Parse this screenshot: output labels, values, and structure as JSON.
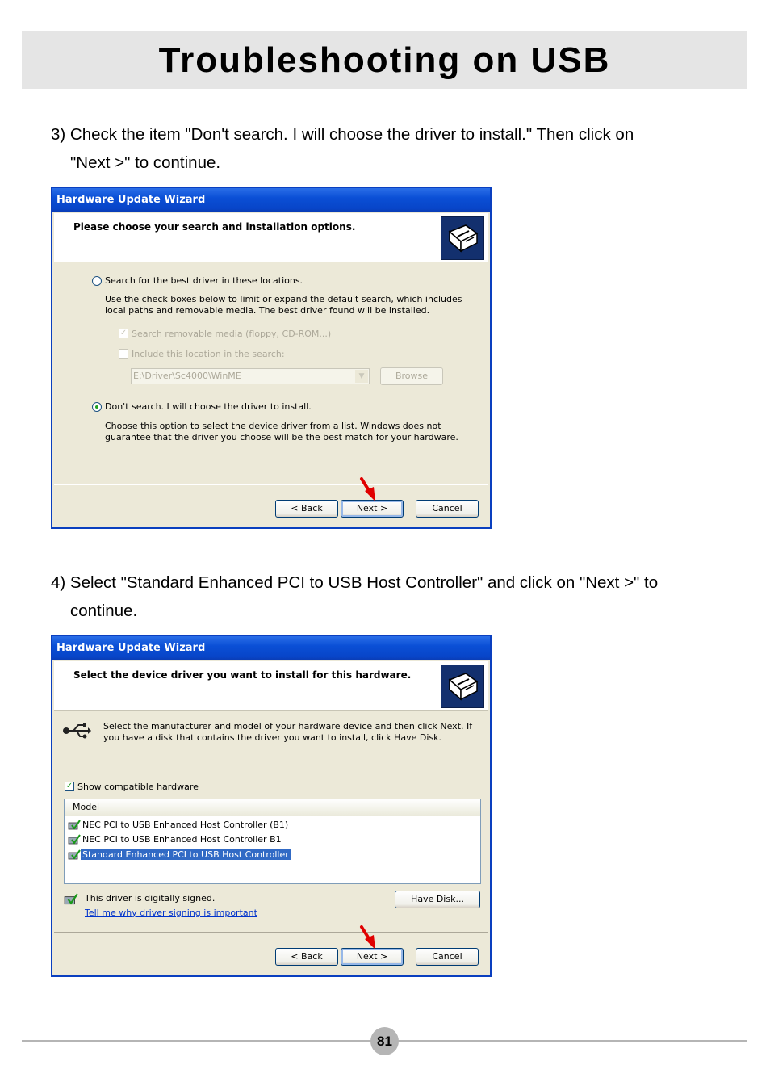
{
  "page_title": "Troubleshooting on USB",
  "page_number": "81",
  "steps": [
    {
      "line1": "3) Check the item \"Don't search. I will choose the driver to install.\" Then click on",
      "line2": "\"Next >\" to continue."
    },
    {
      "line1": "4) Select \"Standard Enhanced PCI to USB Host Controller\" and click on \"Next >\" to",
      "line2": "continue."
    }
  ],
  "dialog1": {
    "title": "Hardware Update Wizard",
    "header": "Please choose your search and installation options.",
    "option_search": "Search for the best driver in these locations.",
    "option_search_desc": "Use the check boxes below to limit or expand the default search, which includes local paths and removable media. The best driver found will be installed.",
    "chk_removable": "Search removable media (floppy, CD-ROM...)",
    "chk_location": "Include this location in the search:",
    "path_value": "E:\\Driver\\Sc4000\\WinME",
    "browse": "Browse",
    "option_dont": "Don't search. I will choose the driver to install.",
    "option_dont_desc": "Choose this option to select the device driver from a list.  Windows does not guarantee that the driver you choose will be the best match for your hardware.",
    "back": "< Back",
    "next": "Next >",
    "cancel": "Cancel"
  },
  "dialog2": {
    "title": "Hardware Update Wizard",
    "header": "Select the device driver you want to install for this hardware.",
    "info": "Select the manufacturer and model of your hardware device and then click Next. If you have a disk that contains the driver you want to install, click Have Disk.",
    "show_compatible": "Show compatible hardware",
    "model_header": "Model",
    "models": [
      "NEC PCI to USB Enhanced Host Controller (B1)",
      "NEC PCI to USB Enhanced Host Controller B1",
      "Standard Enhanced PCI to USB Host Controller"
    ],
    "signed": "This driver is digitally signed.",
    "signing_link": "Tell me why driver signing is important",
    "have_disk": "Have Disk...",
    "back": "< Back",
    "next": "Next >",
    "cancel": "Cancel"
  }
}
